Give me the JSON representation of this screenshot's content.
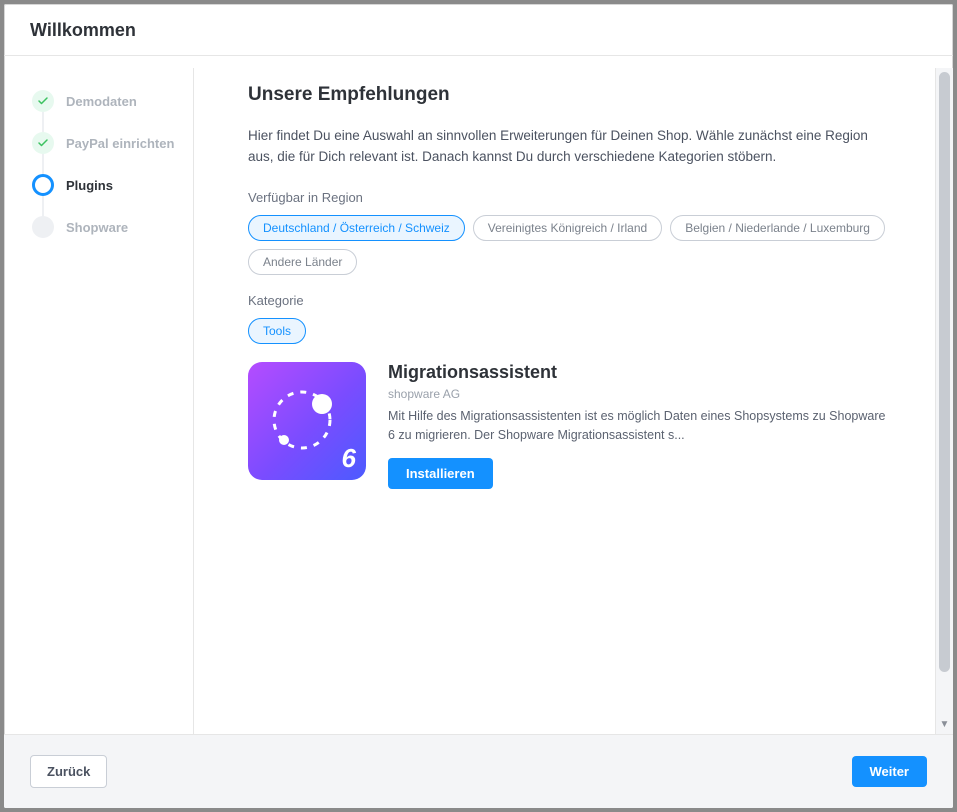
{
  "header": {
    "title": "Willkommen"
  },
  "steps": [
    {
      "label": "Demodaten",
      "state": "done"
    },
    {
      "label": "PayPal einrichten",
      "state": "done"
    },
    {
      "label": "Plugins",
      "state": "active"
    },
    {
      "label": "Shopware",
      "state": "upcoming"
    }
  ],
  "main": {
    "title": "Unsere Empfehlungen",
    "intro": "Hier findet Du eine Auswahl an sinnvollen Erweiterungen für Deinen Shop. Wähle zunächst eine Region aus, die für Dich relevant ist. Danach kannst Du durch verschiedene Kategorien stöbern.",
    "region_label": "Verfügbar in Region",
    "regions": [
      {
        "label": "Deutschland / Österreich / Schweiz",
        "active": true
      },
      {
        "label": "Vereinigtes Königreich / Irland",
        "active": false
      },
      {
        "label": "Belgien / Niederlande / Luxemburg",
        "active": false
      },
      {
        "label": "Andere Länder",
        "active": false
      }
    ],
    "category_label": "Kategorie",
    "categories": [
      {
        "label": "Tools",
        "active": true
      }
    ],
    "plugins": [
      {
        "title": "Migrationsassistent",
        "publisher": "shopware AG",
        "description": "Mit Hilfe des Migrationsassistenten ist es möglich Daten eines Shopsystems zu Shopware 6 zu migrieren. Der Shopware Migrationsassistent s...",
        "install_label": "Installieren",
        "icon_badge": "6"
      }
    ]
  },
  "footer": {
    "back": "Zurück",
    "next": "Weiter"
  }
}
